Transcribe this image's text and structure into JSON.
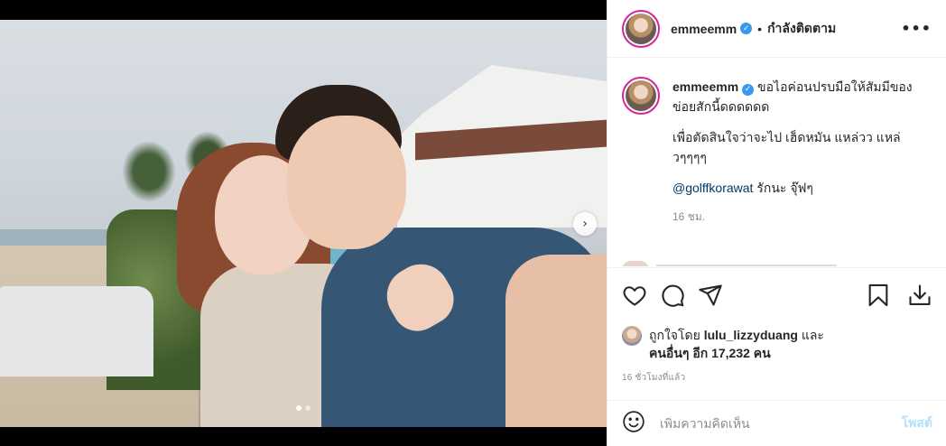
{
  "post": {
    "username": "emmeemm",
    "follow_status": "กำลังติดตาม",
    "more_glyph": "•••",
    "caption_line1": "ขอไอค่อนปรบมือให้สัมมีของข่อยสักนี้ดดดดดด",
    "caption_line2": "เพื่อตัดสินใจว่าจะไป เฮ็ดหมัน แหล่วว แหล่วๆๆๆๆ",
    "caption_mention": "@golffkorawat",
    "caption_mention_suffix": " รักนะ จุ๊ฟๆ",
    "caption_time": "16 ชม."
  },
  "likes": {
    "prefix": "ถูกใจโดย ",
    "liker": "lulu_lizzyduang",
    "joiner": " และ",
    "others": "คนอื่นๆ อีก 17,232 คน"
  },
  "posted_ago": "16 ชั่วโมงที่แล้ว",
  "comment": {
    "placeholder": "เพิ่มความคิดเห็น",
    "post_label": "โพสต์"
  },
  "carousel": {
    "slide_count": 2,
    "active_slide": 1,
    "next_glyph": "›"
  },
  "colors": {
    "verified": "#3897f0",
    "post_button_disabled": "#b2dffc",
    "story_ring": "#d6249f",
    "mention": "#00376b"
  },
  "icons": [
    "heart-icon",
    "comment-icon",
    "share-icon",
    "bookmark-icon",
    "download-icon",
    "emoji-icon",
    "verified-icon"
  ]
}
